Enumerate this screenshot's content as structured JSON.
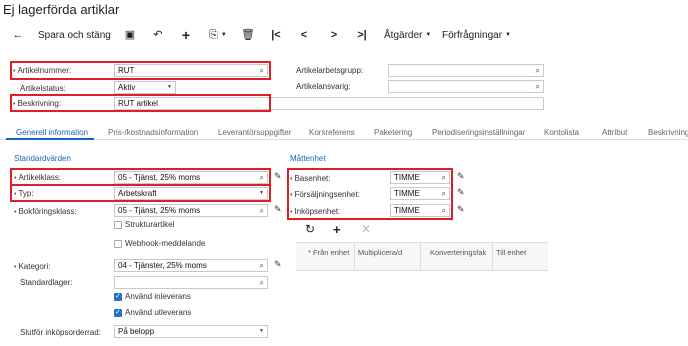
{
  "page": {
    "title": "Ej lagerförda artiklar"
  },
  "toolbar": {
    "back_icon": "arrow-left-icon",
    "save_close": "Spara och stäng",
    "save_icon": "floppy-disk-icon",
    "undo_icon": "undo-icon",
    "add_icon": "plus-icon",
    "copy_icon": "copy-paste-icon",
    "delete_icon": "trash-icon",
    "first_icon": "first-record-icon",
    "prev_icon": "previous-icon",
    "next_icon": "next-icon",
    "last_icon": "last-record-icon",
    "actions": "Åtgärder",
    "inquiries": "Förfrågningar"
  },
  "header": {
    "item_number_label": "Artikelnummer:",
    "item_number_value": "RUT",
    "item_status_label": "Artikelstatus:",
    "item_status_value": "Aktiv",
    "description_label": "Beskrivning:",
    "description_value": "RUT artikel",
    "work_group_label": "Artikelarbetsgrupp:",
    "work_group_value": "",
    "manager_label": "Artikelansvarig:",
    "manager_value": ""
  },
  "tabs": [
    {
      "label": "Generell information"
    },
    {
      "label": "Pris-/kostnadsinformation"
    },
    {
      "label": "Leverantörsuppgifter"
    },
    {
      "label": "Korsreferens"
    },
    {
      "label": "Paketering"
    },
    {
      "label": "Periodiseringsinställningar"
    },
    {
      "label": "Kontolista"
    },
    {
      "label": "Attribut"
    },
    {
      "label": "Beskrivning"
    }
  ],
  "defaults": {
    "section": "Standardvärden",
    "item_class_label": "Artikelklass:",
    "item_class_value": "05 - Tjänst, 25% moms",
    "type_label": "Typ:",
    "type_value": "Arbetskraft",
    "posting_class_label": "Bokföringsklass:",
    "posting_class_value": "05 - Tjänst, 25% moms",
    "structure_item": "Strukturartikel",
    "webhook": "Webhook-meddelande",
    "category_label": "Kategori:",
    "category_value": "04 - Tjänster, 25% moms",
    "default_warehouse_label": "Standardlager:",
    "default_warehouse_value": "",
    "use_receipt": "Använd inleverans",
    "use_delivery": "Använd utleverans",
    "complete_po_label": "Slutför inköpsorderrad:",
    "complete_po_value": "På belopp"
  },
  "uom": {
    "section": "Måttenhet",
    "base_label": "Basenhet:",
    "base_value": "TIMME",
    "sales_label": "Försäljningsenhet:",
    "sales_value": "TIMME",
    "purchase_label": "Inköpsenhet:",
    "purchase_value": "TIMME",
    "grid_refresh_icon": "refresh-icon",
    "grid_add_icon": "plus-icon",
    "grid_delete_icon": "close-icon",
    "columns": [
      "Från enhet",
      "Multiplicera/d",
      "Konverteringsfak",
      "Till enhet"
    ]
  },
  "colors": {
    "accent": "#1a62b8",
    "highlight": "#e01e26",
    "checkbox": "#2573c4"
  }
}
